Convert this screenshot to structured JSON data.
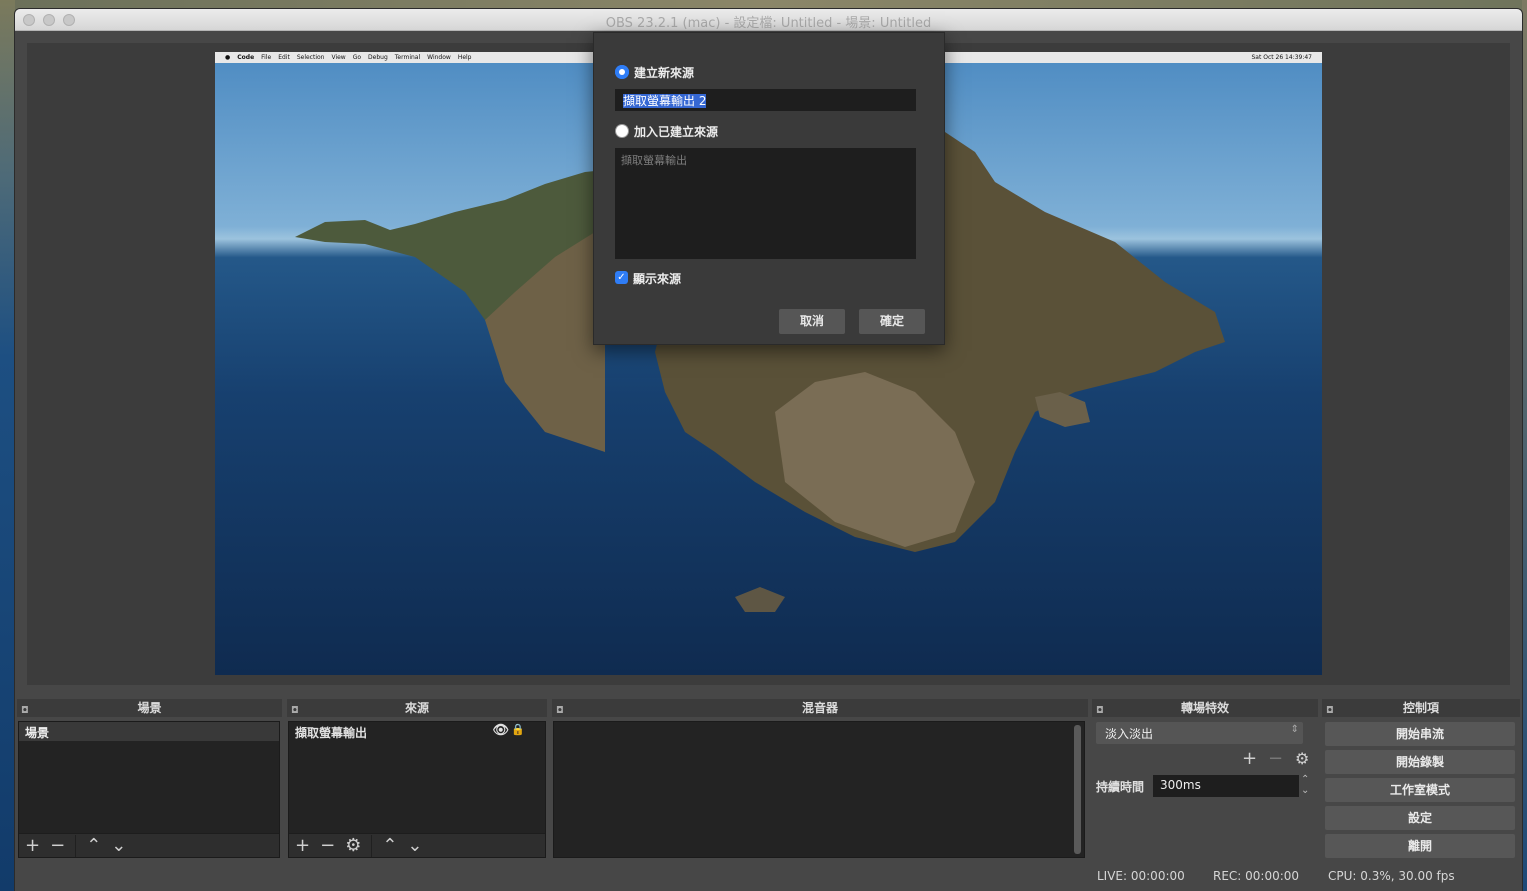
{
  "window": {
    "title": "OBS 23.2.1 (mac) - 設定檔: Untitled - 場景: Untitled"
  },
  "captured_screen": {
    "menubar": [
      "Code",
      "File",
      "Edit",
      "Selection",
      "View",
      "Go",
      "Debug",
      "Terminal",
      "Window",
      "Help"
    ],
    "clock": "Sat Oct 26  14:39:47"
  },
  "dialog": {
    "create_new_label": "建立新來源",
    "new_source_name": "擷取螢幕輸出 2",
    "add_existing_label": "加入已建立來源",
    "existing_sources": [
      "擷取螢幕輸出"
    ],
    "make_visible_label": "顯示來源",
    "cancel_label": "取消",
    "ok_label": "確定"
  },
  "scenes": {
    "title": "場景",
    "items": [
      "場景"
    ]
  },
  "sources": {
    "title": "來源",
    "items": [
      "擷取螢幕輸出"
    ]
  },
  "mixer": {
    "title": "混音器"
  },
  "transitions": {
    "title": "轉場特效",
    "selected": "淡入淡出",
    "duration_label": "持續時間",
    "duration_value": "300ms"
  },
  "controls": {
    "title": "控制項",
    "buttons": [
      "開始串流",
      "開始錄製",
      "工作室模式",
      "設定",
      "離開"
    ]
  },
  "status": {
    "live": "LIVE: 00:00:00",
    "rec": "REC: 00:00:00",
    "cpu": "CPU: 0.3%, 30.00 fps"
  },
  "colors": {
    "accent": "#2f7df6",
    "selection": "#3567d3",
    "panel": "#232323",
    "window": "#474747"
  }
}
